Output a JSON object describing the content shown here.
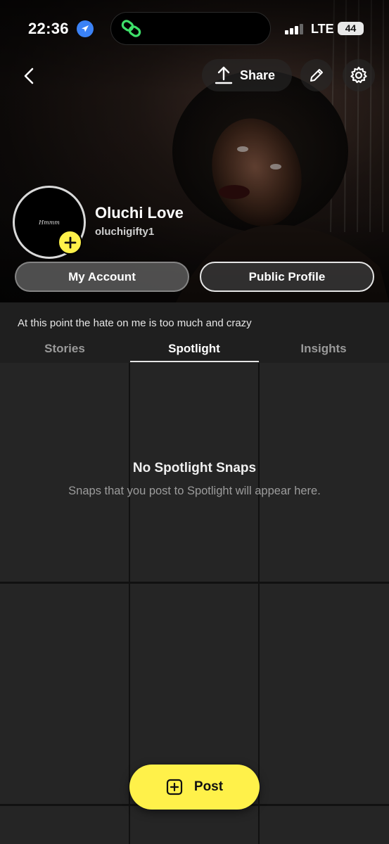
{
  "status_bar": {
    "time": "22:36",
    "network": "LTE",
    "battery": "44"
  },
  "header": {
    "share_label": "Share"
  },
  "profile": {
    "display_name": "Oluchi Love",
    "username": "oluchigifty1",
    "avatar_text": "Hmmm",
    "bio": "At this point the hate on me is too much and crazy"
  },
  "buttons": {
    "my_account": "My Account",
    "public_profile": "Public Profile",
    "post": "Post"
  },
  "tabs": [
    {
      "label": "Stories"
    },
    {
      "label": "Spotlight"
    },
    {
      "label": "Insights"
    }
  ],
  "empty_state": {
    "title": "No Spotlight Snaps",
    "subtitle": "Snaps that you post to Spotlight will appear here."
  },
  "colors": {
    "accent_yellow": "#fff14a",
    "location_blue": "#3b82f6",
    "island_green": "#3ee06a"
  },
  "icons": [
    "location-arrow-icon",
    "link-icon",
    "back-chevron-icon",
    "share-upload-icon",
    "pencil-icon",
    "gear-icon",
    "plus-icon",
    "add-post-icon"
  ]
}
